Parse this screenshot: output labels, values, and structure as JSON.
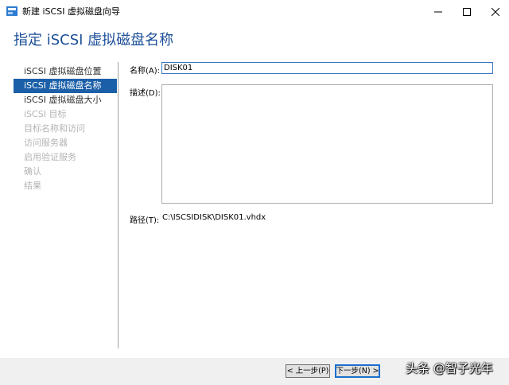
{
  "window": {
    "title": "新建 iSCSI 虚拟磁盘向导",
    "page_title": "指定 iSCSI 虚拟磁盘名称"
  },
  "nav": {
    "items": [
      {
        "label": "iSCSI 虚拟磁盘位置",
        "state": "normal"
      },
      {
        "label": "iSCSI 虚拟磁盘名称",
        "state": "active"
      },
      {
        "label": "iSCSI 虚拟磁盘大小",
        "state": "normal"
      },
      {
        "label": "iSCSI 目标",
        "state": "disabled"
      },
      {
        "label": "目标名称和访问",
        "state": "disabled"
      },
      {
        "label": "访问服务器",
        "state": "disabled"
      },
      {
        "label": "启用验证服务",
        "state": "disabled"
      },
      {
        "label": "确认",
        "state": "disabled"
      },
      {
        "label": "结果",
        "state": "disabled"
      }
    ]
  },
  "form": {
    "name_label": "名称(A):",
    "name_value": "DISK01",
    "desc_label": "描述(D):",
    "desc_value": "",
    "path_label": "路径(T):",
    "path_value": "C:\\ISCSIDISK\\DISK01.vhdx"
  },
  "buttons": {
    "prev": "< 上一步(P)",
    "next": "下一步(N) >"
  },
  "watermark": "头条 @智子光年",
  "colors": {
    "accent": "#1b5fa8",
    "title_text": "#1c4f99"
  }
}
